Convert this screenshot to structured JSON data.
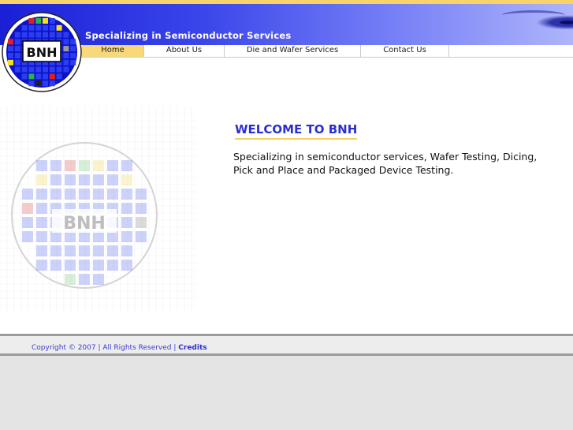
{
  "header": {
    "tagline": "Specializing in Semiconductor Services",
    "logo_text": "BNH"
  },
  "nav": {
    "items": [
      {
        "label": "Home",
        "active": true
      },
      {
        "label": "About Us",
        "active": false
      },
      {
        "label": "Die and Wafer Services",
        "active": false
      },
      {
        "label": "Contact Us",
        "active": false
      }
    ]
  },
  "main": {
    "heading": "WELCOME TO BNH",
    "intro": "Specializing in semiconductor services, Wafer Testing, Dicing, Pick and Place and Packaged Device Testing.",
    "watermark_text": "BNH"
  },
  "footer": {
    "copyright": "Copyright © 2007 | All Rights Reserved | ",
    "credits_label": "Credits"
  },
  "colors": {
    "banner_blue": "#1a1fd6",
    "accent_yellow": "#f7d97a",
    "heading_blue": "#2b2fd2"
  }
}
